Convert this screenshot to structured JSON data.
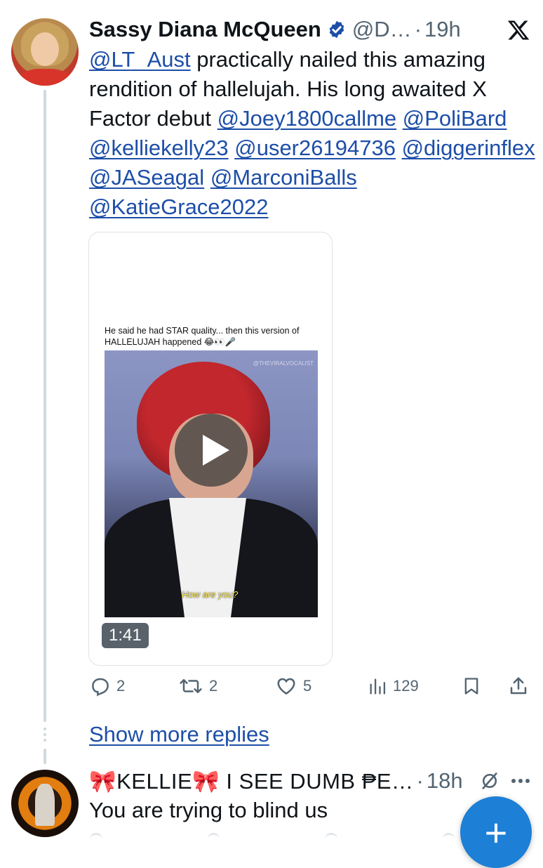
{
  "tweet": {
    "display_name": "Sassy Diana McQueen",
    "handle": "@D…",
    "separator": "·",
    "time": "19h",
    "text_parts": {
      "m1": "@LT_Aust",
      "t1": " practically nailed this amazing rendition of hallelujah. His long awaited X Factor debut ",
      "m2": "@Joey1800callme",
      "m3": "@PoliBard",
      "m4": "@kelliekelly23",
      "m5": "@user26194736",
      "m6": "@diggerinflex",
      "m7": "@JASeagal",
      "m8": "@MarconiBalls",
      "m9": "@KatieGrace2022"
    },
    "media": {
      "caption": "He said he had STAR quality... then this version of HALLELUJAH happened 😂👀🎤",
      "watermark": "@THEVIRALVOCALIST",
      "subtitle": "How are you?",
      "duration": "1:41"
    },
    "actions": {
      "replies": "2",
      "reposts": "2",
      "likes": "5",
      "views": "129"
    },
    "show_more": "Show more replies"
  },
  "reply": {
    "display_name": "🎀KELLIE🎀 I SEE DUMB ₱E…",
    "separator": "·",
    "time": "18h",
    "text": "You are trying to blind us"
  },
  "fab": {
    "label": "+"
  },
  "colors": {
    "link": "#1d4ea8",
    "muted": "#536471",
    "fab": "#1d7fd6",
    "verified": "#1d4ea8"
  },
  "icons": [
    "verified-badge-icon",
    "x-logo-icon",
    "reply-icon",
    "repost-icon",
    "like-icon",
    "views-icon",
    "bookmark-icon",
    "share-icon",
    "grok-icon",
    "more-icon",
    "play-icon"
  ]
}
